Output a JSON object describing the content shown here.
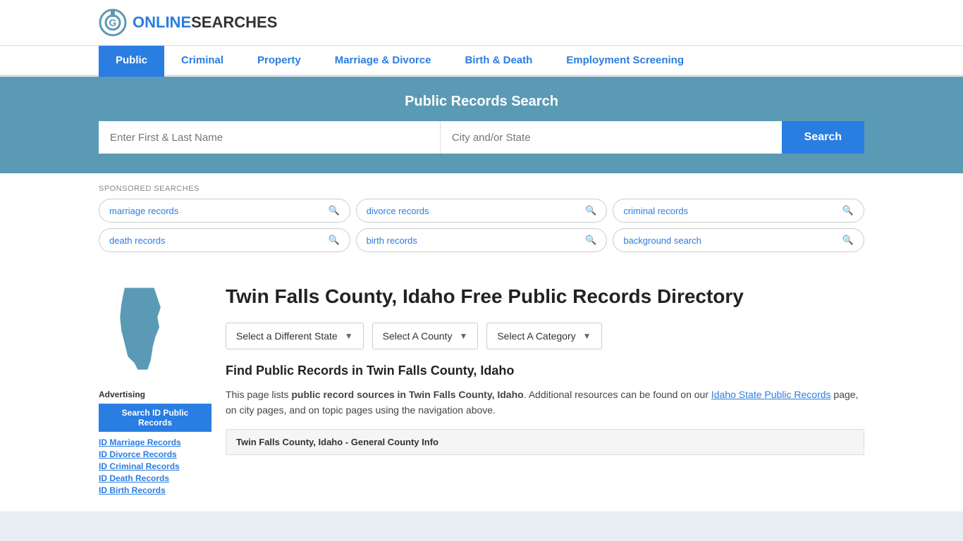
{
  "logo": {
    "icon_letter": "G",
    "brand_prefix": "ONLINE",
    "brand_suffix": "SEARCHES"
  },
  "nav": {
    "items": [
      {
        "label": "Public",
        "active": true
      },
      {
        "label": "Criminal",
        "active": false
      },
      {
        "label": "Property",
        "active": false
      },
      {
        "label": "Marriage & Divorce",
        "active": false
      },
      {
        "label": "Birth & Death",
        "active": false
      },
      {
        "label": "Employment Screening",
        "active": false
      }
    ]
  },
  "search_banner": {
    "title": "Public Records Search",
    "name_placeholder": "Enter First & Last Name",
    "location_placeholder": "City and/or State",
    "button_label": "Search"
  },
  "sponsored": {
    "label": "SPONSORED SEARCHES",
    "pills": [
      {
        "text": "marriage records"
      },
      {
        "text": "divorce records"
      },
      {
        "text": "criminal records"
      },
      {
        "text": "death records"
      },
      {
        "text": "birth records"
      },
      {
        "text": "background search"
      }
    ]
  },
  "sidebar": {
    "advertising_label": "Advertising",
    "ad_button": "Search ID Public Records",
    "links": [
      "ID Marriage Records",
      "ID Divorce Records",
      "ID Criminal Records",
      "ID Death Records",
      "ID Birth Records"
    ]
  },
  "main": {
    "page_title": "Twin Falls County, Idaho Free Public Records Directory",
    "dropdowns": [
      {
        "label": "Select a Different State"
      },
      {
        "label": "Select A County"
      },
      {
        "label": "Select A Category"
      }
    ],
    "find_title": "Find Public Records in Twin Falls County, Idaho",
    "description_part1": "This page lists ",
    "description_bold": "public record sources in Twin Falls County, Idaho",
    "description_part2": ". Additional resources can be found on our ",
    "description_link": "Idaho State Public Records",
    "description_part3": " page, on city pages, and on topic pages using the navigation above.",
    "county_info_bar": "Twin Falls County, Idaho - General County Info"
  },
  "colors": {
    "primary_blue": "#2a7de1",
    "banner_blue": "#5b9ab5",
    "map_blue": "#5b9ab5"
  }
}
